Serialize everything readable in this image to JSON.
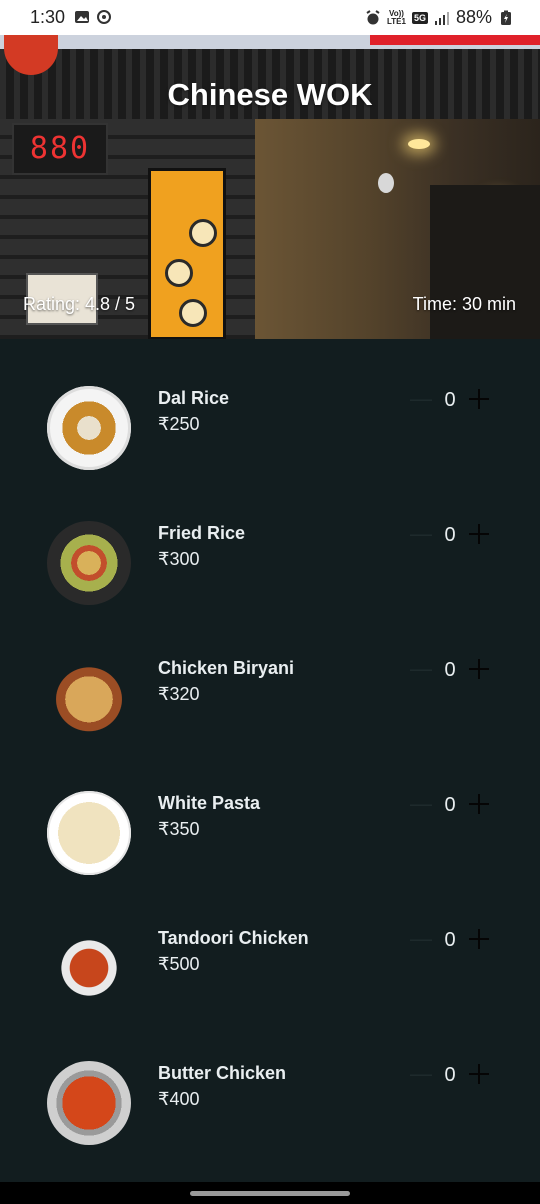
{
  "status_bar": {
    "time": "1:30",
    "network_top": "Vo))",
    "network_bottom": "LTE1",
    "network_type": "5G",
    "battery": "88%"
  },
  "restaurant": {
    "title": "Chinese WOK",
    "rating": "Rating: 4.8 / 5",
    "time": "Time: 30 min",
    "hero_led_text": "880"
  },
  "menu": {
    "items": [
      {
        "name": "Dal Rice",
        "price": "₹250",
        "quantity": "0"
      },
      {
        "name": "Fried Rice",
        "price": "₹300",
        "quantity": "0"
      },
      {
        "name": "Chicken Biryani",
        "price": "₹320",
        "quantity": "0"
      },
      {
        "name": "White Pasta",
        "price": "₹350",
        "quantity": "0"
      },
      {
        "name": "Tandoori Chicken",
        "price": "₹500",
        "quantity": "0"
      },
      {
        "name": "Butter Chicken",
        "price": "₹400",
        "quantity": "0"
      }
    ],
    "minus_symbol": "—"
  },
  "colors": {
    "background": "#121d1f",
    "text": "#e9eef0",
    "plus_icon": "#050505"
  }
}
